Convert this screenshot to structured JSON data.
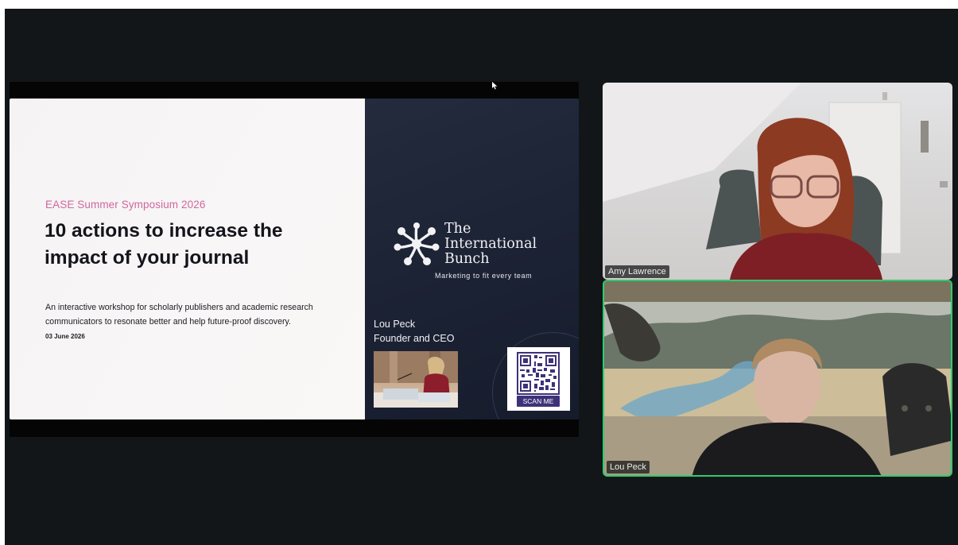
{
  "slide": {
    "kicker": "EASE Summer Symposium 2026",
    "headline": "10 actions to increase the impact of your journal",
    "description": "An interactive workshop for scholarly publishers and academic research communicators to resonate better and help future-proof discovery.",
    "date": "03 June 2026",
    "brand_line1": "The",
    "brand_line2": "International",
    "brand_line3": "Bunch",
    "tagline": "Marketing to fit every team",
    "presenter_name": "Lou Peck",
    "presenter_role": "Founder and CEO",
    "qr_button": "SCAN ME"
  },
  "participants": [
    {
      "name": "Amy Lawrence",
      "active_speaker": false
    },
    {
      "name": "Lou Peck",
      "active_speaker": true
    }
  ],
  "colors": {
    "kicker": "#d0679d",
    "speaker_border": "#2dcc6e",
    "qr_purple": "#3d3279"
  }
}
